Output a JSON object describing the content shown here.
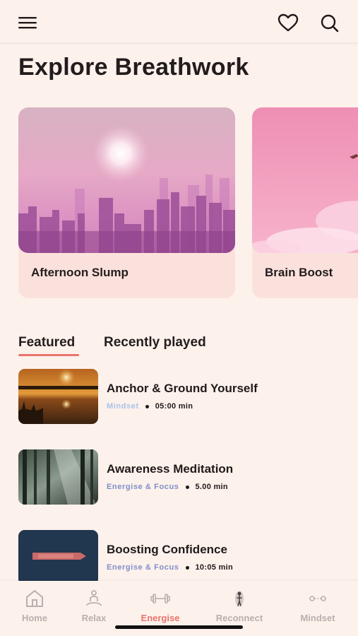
{
  "header": {
    "menu_icon": "hamburger-menu-icon",
    "favorite_icon": "heart-icon",
    "search_icon": "search-icon"
  },
  "page_title": "Explore Breathwork",
  "carousel": [
    {
      "label": "Afternoon Slump",
      "image": "pink-city-skyline-sunset"
    },
    {
      "label": "Brain Boost",
      "image": "pink-sky-clouds-plane"
    }
  ],
  "tabs": [
    {
      "label": "Featured",
      "active": true
    },
    {
      "label": "Recently played",
      "active": false
    }
  ],
  "sessions": [
    {
      "title": "Anchor & Ground Yourself",
      "category": "Mindset",
      "duration": "05:00 min",
      "image": "sunset-lake"
    },
    {
      "title": "Awareness Meditation",
      "category": "Energise & Focus",
      "duration": "5.00 min",
      "image": "forest-light-rays"
    },
    {
      "title": "Boosting Confidence",
      "category": "Energise & Focus",
      "duration": "10:05 min",
      "image": "ship-on-ocean"
    }
  ],
  "nav": [
    {
      "label": "Home",
      "icon": "home-icon",
      "active": false
    },
    {
      "label": "Relax",
      "icon": "meditation-icon",
      "active": false
    },
    {
      "label": "Energise",
      "icon": "dumbbell-icon",
      "active": true
    },
    {
      "label": "Reconnect",
      "icon": "body-figure-icon",
      "active": false
    },
    {
      "label": "Mindset",
      "icon": "mindset-icon",
      "active": false
    }
  ],
  "colors": {
    "background": "#fdf1ec",
    "accent": "#e9746c",
    "category_text": "#7e8fc8",
    "card_bg": "#fbe1dc"
  }
}
